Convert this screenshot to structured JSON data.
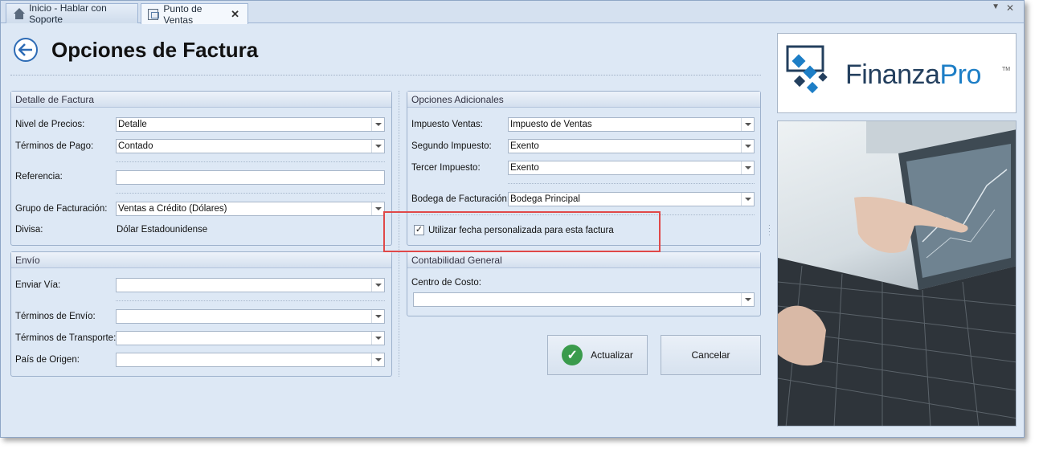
{
  "tabs": [
    {
      "label": "Inicio - Hablar con Soporte"
    },
    {
      "label": "Punto de Ventas"
    }
  ],
  "header": {
    "title": "Opciones de Factura"
  },
  "detalle": {
    "title": "Detalle de Factura",
    "nivel_label": "Nivel de Precios:",
    "nivel_value": "Detalle",
    "terminos_label": "Términos de Pago:",
    "terminos_value": "Contado",
    "referencia_label": "Referencia:",
    "referencia_value": "",
    "grupo_label": "Grupo de Facturación:",
    "grupo_value": "Ventas a Crédito (Dólares)",
    "divisa_label": "Divisa:",
    "divisa_value": "Dólar Estadounidense"
  },
  "envio": {
    "title": "Envío",
    "via_label": "Enviar Vía:",
    "via_value": "",
    "terminos_envio_label": "Términos de Envío:",
    "terminos_envio_value": "",
    "transporte_label": "Términos de Transporte:",
    "transporte_value": "",
    "pais_label": "País de Origen:",
    "pais_value": ""
  },
  "adicionales": {
    "title": "Opciones Adicionales",
    "impuesto_label": "Impuesto Ventas:",
    "impuesto_value": "Impuesto de Ventas",
    "segundo_label": "Segundo Impuesto:",
    "segundo_value": "Exento",
    "tercer_label": "Tercer Impuesto:",
    "tercer_value": "Exento",
    "bodega_label": "Bodega de Facturación:",
    "bodega_value": "Bodega Principal",
    "custom_date_label": "Utilizar fecha personalizada para esta factura",
    "custom_date_checked": true
  },
  "contabilidad": {
    "title": "Contabilidad General",
    "centro_label": "Centro de Costo:",
    "centro_value": ""
  },
  "buttons": {
    "update": "Actualizar",
    "cancel": "Cancelar"
  },
  "logo": {
    "brand": "Finanza",
    "brand_accent": "Pro",
    "tm": "TM"
  },
  "colors": {
    "accent": "#2d6bb5",
    "highlight": "#e04848",
    "success": "#3a9b4c"
  }
}
